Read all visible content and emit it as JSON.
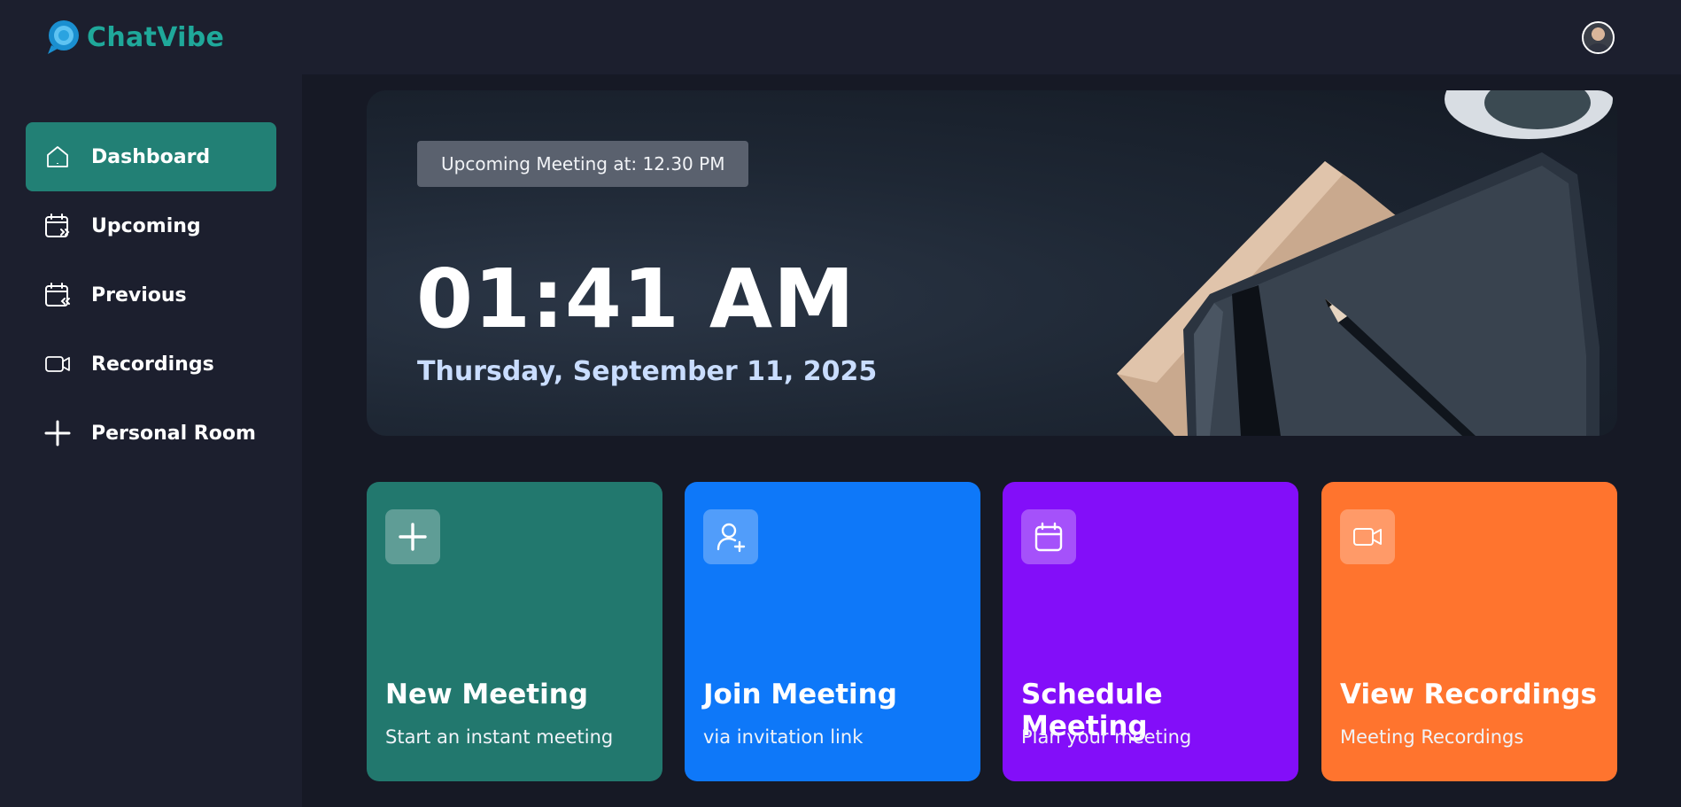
{
  "app": {
    "name": "ChatVibe",
    "accent": "#1fa89a"
  },
  "header": {
    "avatar_icon": "user-avatar"
  },
  "sidebar": {
    "items": [
      {
        "label": "Dashboard",
        "icon": "home-icon",
        "active": true
      },
      {
        "label": "Upcoming",
        "icon": "calendar-forward-icon",
        "active": false
      },
      {
        "label": "Previous",
        "icon": "calendar-back-icon",
        "active": false
      },
      {
        "label": "Recordings",
        "icon": "video-icon",
        "active": false
      },
      {
        "label": "Personal Room",
        "icon": "plus-icon",
        "active": false
      }
    ]
  },
  "hero": {
    "badge": "Upcoming Meeting at: 12.30 PM",
    "time": "01:41 AM",
    "date": "Thursday, September 11, 2025"
  },
  "cards": [
    {
      "title": "New Meeting",
      "subtitle": "Start an instant meeting",
      "icon": "plus-icon",
      "color": "#22786e"
    },
    {
      "title": "Join Meeting",
      "subtitle": "via invitation link",
      "icon": "user-add-icon",
      "color": "#0e78f9"
    },
    {
      "title": "Schedule Meeting",
      "subtitle": "Plan your meeting",
      "icon": "calendar-icon",
      "color": "#830ef9"
    },
    {
      "title": "View Recordings",
      "subtitle": "Meeting Recordings",
      "icon": "video-icon",
      "color": "#ff742e"
    }
  ]
}
